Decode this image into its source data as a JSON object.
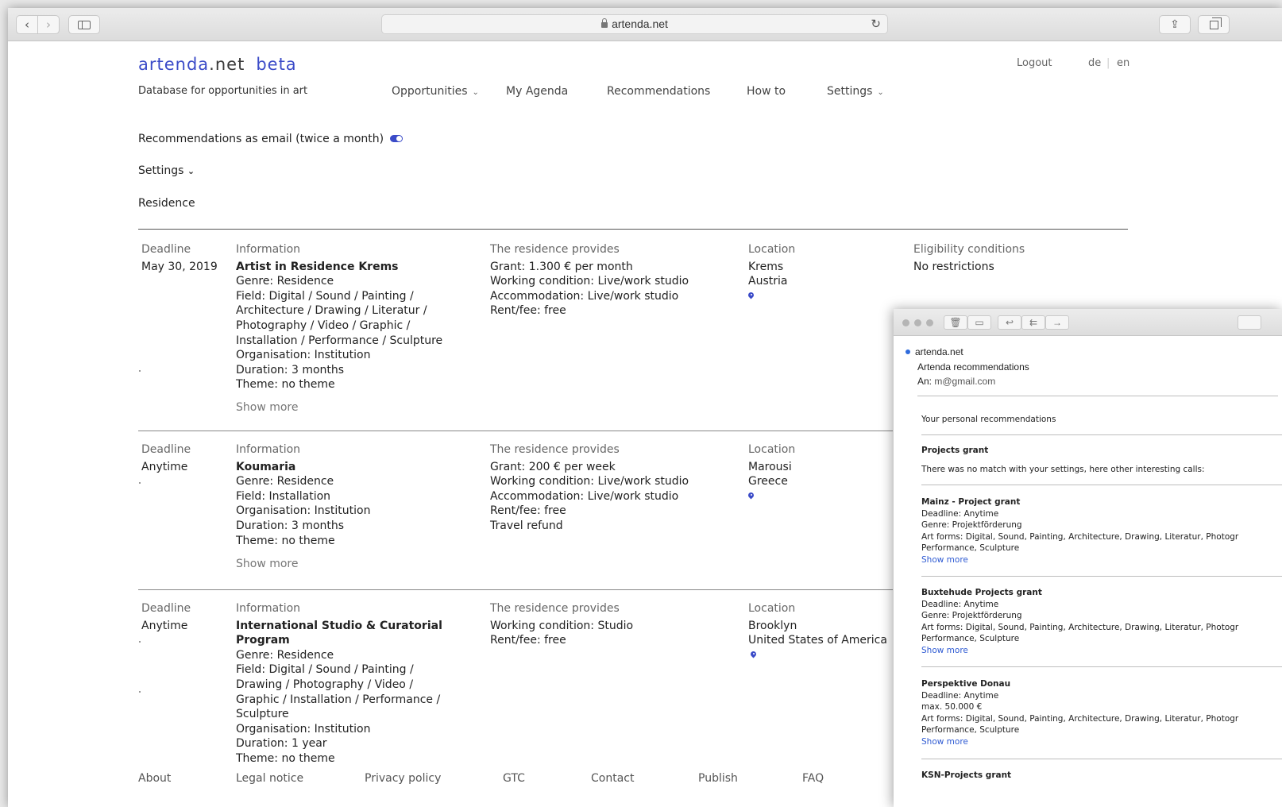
{
  "browser": {
    "url": "artenda.net",
    "nav": {
      "back": "‹",
      "forward": "›",
      "reload": "↻",
      "share": "⇪"
    },
    "icons": [
      "back-icon",
      "forward-icon",
      "sidebar-icon",
      "lock-icon",
      "reload-icon",
      "share-icon",
      "tabs-icon"
    ]
  },
  "site": {
    "logo_main": "artenda",
    "logo_tld": ".net",
    "logo_beta": "beta",
    "tagline": "Database for opportunities in art",
    "nav": [
      {
        "label": "Opportunities",
        "dropdown": true
      },
      {
        "label": "My Agenda"
      },
      {
        "label": "Recommendations"
      },
      {
        "label": "How to"
      },
      {
        "label": "Settings",
        "dropdown": true
      }
    ],
    "logout": "Logout",
    "lang_de": "de",
    "lang_sep": "|",
    "lang_en": "en",
    "accent": "#3b4bc8"
  },
  "prefs": {
    "email_toggle_label": "Recommendations as email (twice a month)",
    "email_toggle_on": true,
    "settings_label": "Settings",
    "settings_caret": "⌄",
    "category": "Residence"
  },
  "columns": {
    "deadline": "Deadline",
    "information": "Information",
    "provides": "The residence provides",
    "location": "Location",
    "eligibility": "Eligibility conditions"
  },
  "listings": [
    {
      "deadline": "May 30, 2019",
      "title": "Artist in Residence Krems",
      "info": [
        "Genre: Residence",
        "Field: Digital / Sound / Painting /",
        "Architecture / Drawing / Literatur /",
        "Photography / Video / Graphic /",
        "Installation / Performance / Sculpture",
        "Organisation: Institution",
        "Duration: 3 months",
        "Theme: no theme"
      ],
      "provides": [
        "Grant: 1.300 € per month",
        "Working condition: Live/work studio",
        "Accommodation: Live/work studio",
        "Rent/fee: free"
      ],
      "location": [
        "Krems",
        "Austria"
      ],
      "eligibility": "No restrictions",
      "show_more": "Show more"
    },
    {
      "deadline": "Anytime",
      "title": "Koumaria",
      "info": [
        "Genre: Residence",
        "Field: Installation",
        "Organisation: Institution",
        "Duration: 3 months",
        "Theme: no theme"
      ],
      "provides": [
        "Grant: 200 € per week",
        "Working condition: Live/work studio",
        "Accommodation: Live/work studio",
        "Rent/fee: free",
        "Travel refund"
      ],
      "location": [
        "Marousi",
        "Greece"
      ],
      "show_more": "Show more"
    },
    {
      "deadline": "Anytime",
      "title_lines": [
        "International Studio & Curatorial",
        "Program"
      ],
      "info": [
        "Genre: Residence",
        "Field: Digital / Sound / Painting /",
        "Drawing / Photography / Video /",
        "Graphic / Installation / Performance /",
        "Sculpture",
        "Organisation: Institution",
        "Duration: 1 year",
        "Theme: no theme"
      ],
      "provides": [
        "Working condition: Studio",
        "Rent/fee: free"
      ],
      "location": [
        "Brooklyn",
        "United States of America"
      ]
    }
  ],
  "footer": [
    "About",
    "Legal notice",
    "Privacy policy",
    "GTC",
    "Contact",
    "Publish",
    "FAQ"
  ],
  "mail": {
    "toolbar": {
      "delete": "🗑",
      "archive": "▭",
      "reply": "↩",
      "reply_all": "⇇",
      "forward": "→"
    },
    "sender": "artenda.net",
    "subject": "Artenda recommendations",
    "to_label": "An:",
    "to": "m@gmail.com",
    "intro": "Your personal recommendations",
    "section": "Projects grant",
    "no_match": "There was no match with your settings, here other interesting calls:",
    "items": [
      {
        "title": "Mainz - Project grant",
        "lines": [
          "Deadline: Anytime",
          "Genre: Projektförderung",
          "Art forms: Digital, Sound, Painting, Architecture, Drawing, Literatur, Photogr",
          "Performance, Sculpture"
        ],
        "link": "Show more"
      },
      {
        "title": "Buxtehude Projects grant",
        "lines": [
          "Deadline: Anytime",
          "Genre: Projektförderung",
          "Art forms: Digital, Sound, Painting, Architecture, Drawing, Literatur, Photogr",
          "Performance, Sculpture"
        ],
        "link": "Show more"
      },
      {
        "title": "Perspektive Donau",
        "lines": [
          "Deadline: Anytime",
          "max. 50.000 €",
          "Art forms: Digital, Sound, Painting, Architecture, Drawing, Literatur, Photogr",
          "Performance, Sculpture"
        ],
        "link": "Show more"
      },
      {
        "title": "KSN-Projects grant",
        "lines": [],
        "link": ""
      }
    ]
  }
}
